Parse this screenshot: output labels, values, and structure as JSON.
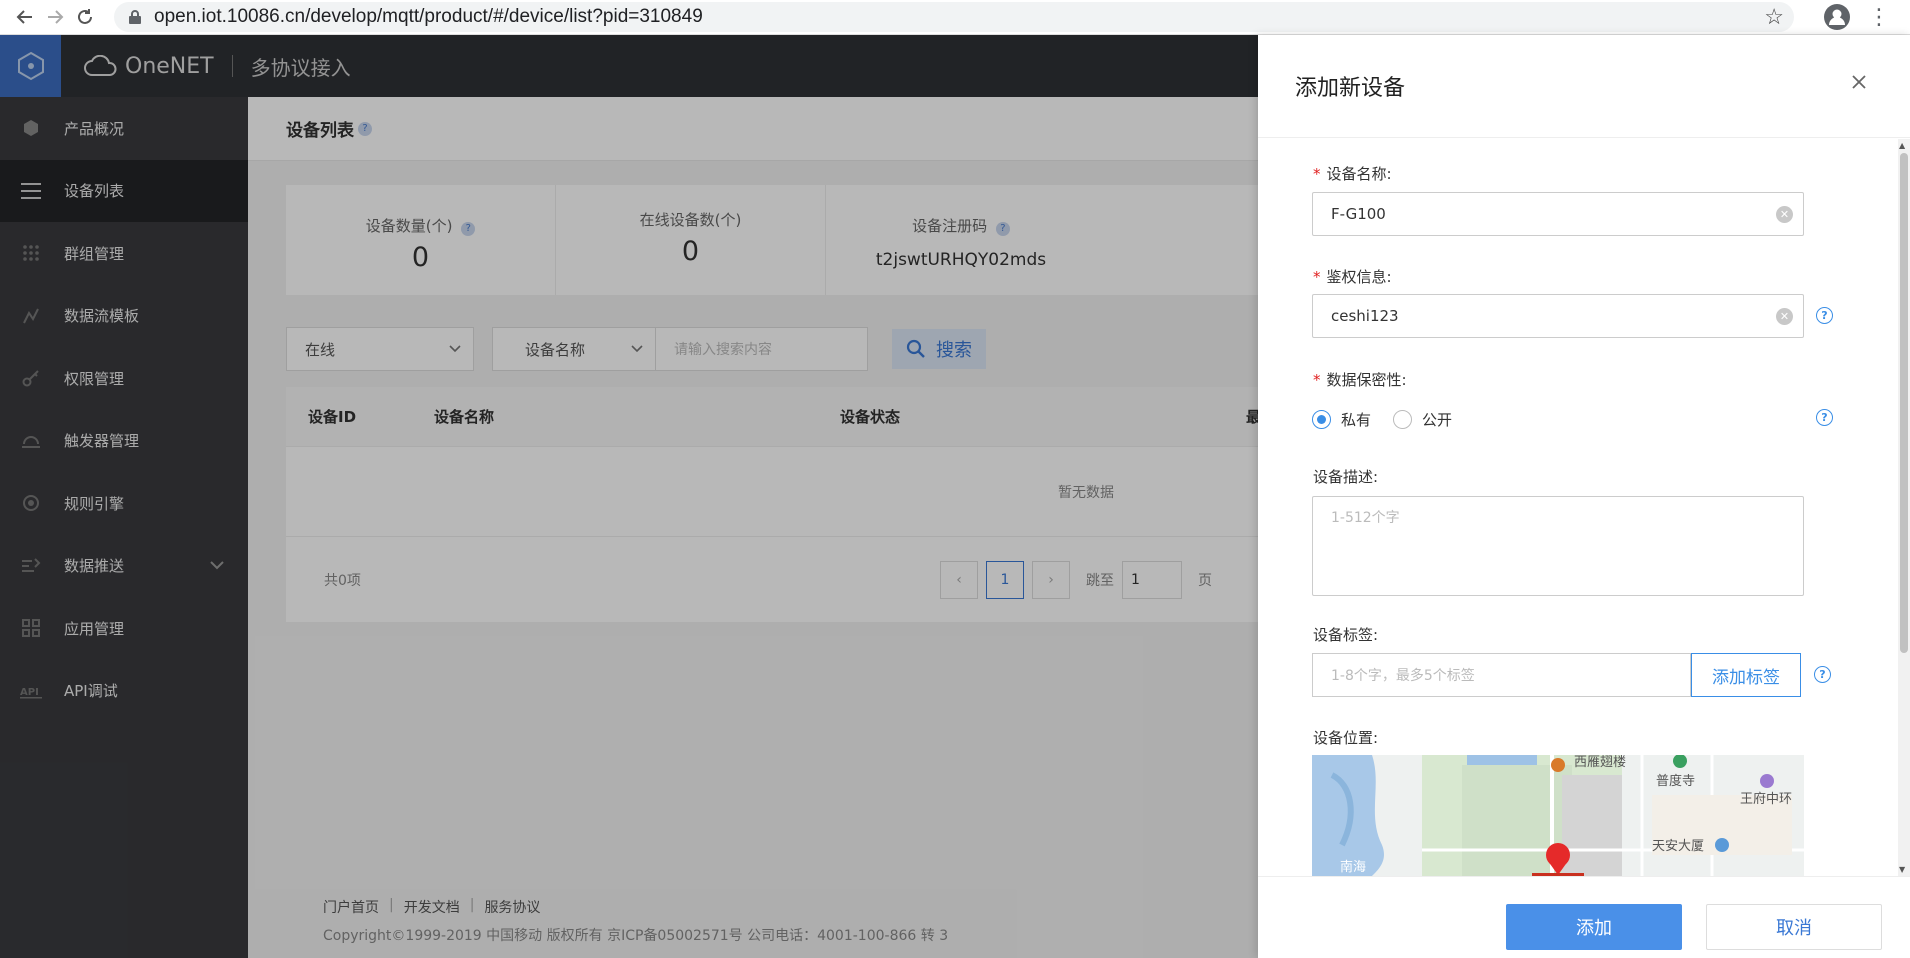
{
  "browser": {
    "url": "open.iot.10086.cn/develop/mqtt/product/#/device/list?pid=310849"
  },
  "header": {
    "brand": "OneNET",
    "subtitle": "多协议接入"
  },
  "sidebar": {
    "items": [
      {
        "label": "产品概况",
        "icon": "cube-icon"
      },
      {
        "label": "设备列表",
        "icon": "list-icon",
        "active": true
      },
      {
        "label": "群组管理",
        "icon": "grid-dots-icon"
      },
      {
        "label": "数据流模板",
        "icon": "stream-icon"
      },
      {
        "label": "权限管理",
        "icon": "key-icon"
      },
      {
        "label": "触发器管理",
        "icon": "trigger-icon"
      },
      {
        "label": "规则引擎",
        "icon": "rule-icon"
      },
      {
        "label": "数据推送",
        "icon": "push-icon"
      },
      {
        "label": "应用管理",
        "icon": "apps-icon"
      },
      {
        "label": "API调试",
        "icon": "api-icon"
      }
    ]
  },
  "main": {
    "page_title": "设备列表",
    "stats": {
      "device_count_label": "设备数量(个)",
      "device_count_value": "0",
      "online_label": "在线设备数(个)",
      "online_value": "0",
      "reg_code_label": "设备注册码",
      "reg_code_value": "t2jswtURHQY02mds"
    },
    "filter": {
      "status_select": "在线",
      "field_select": "设备名称",
      "search_placeholder": "请输入搜索内容",
      "search_button": "搜索"
    },
    "table": {
      "columns": [
        "设备ID",
        "设备名称",
        "设备状态",
        "最"
      ],
      "empty_text": "暂无数据"
    },
    "pagination": {
      "total": "共0项",
      "current_page": "1",
      "jump_label": "跳至",
      "jump_value": "1",
      "page_unit": "页"
    },
    "footer": {
      "links": [
        "门户首页",
        "开发文档",
        "服务协议"
      ],
      "copyright": "Copyright©1999-2019 中国移动 版权所有 京ICP备05002571号 公司电话：4001-100-866 转 3"
    }
  },
  "drawer": {
    "title": "添加新设备",
    "device_name_label": "设备名称:",
    "device_name_value": "F-G100",
    "auth_label": "鉴权信息:",
    "auth_value": "ceshi123",
    "privacy_label": "数据保密性:",
    "privacy_options": [
      "私有",
      "公开"
    ],
    "privacy_selected": "私有",
    "desc_label": "设备描述:",
    "desc_placeholder": "1-512个字",
    "tag_label": "设备标签:",
    "tag_placeholder": "1-8个字，最多5个标签",
    "tag_button": "添加标签",
    "location_label": "设备位置:",
    "map_labels": [
      "西雁翅楼",
      "普度寺",
      "王府中环",
      "天安大厦",
      "南海"
    ],
    "submit_button": "添加",
    "cancel_button": "取消"
  },
  "colors": {
    "accent": "#3a8ee6",
    "primary_button": "#4a90e8",
    "sidebar_bg": "#393a3e",
    "header_bg": "#2f3135",
    "required": "#e02020"
  }
}
